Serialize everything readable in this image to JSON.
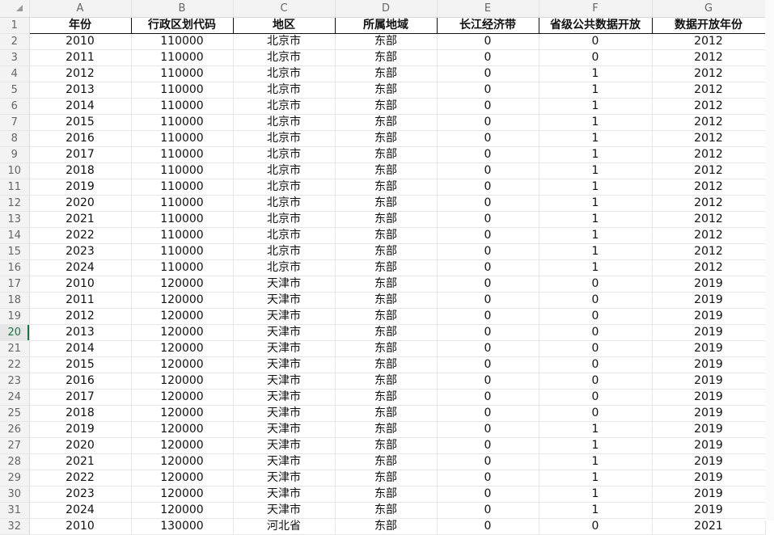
{
  "corner_icon": "select-all-triangle-icon",
  "columns": [
    "A",
    "B",
    "C",
    "D",
    "E",
    "F",
    "G"
  ],
  "active_row": 20,
  "header": {
    "row": 1,
    "cells": [
      "年份",
      "行政区划代码",
      "地区",
      "所属地域",
      "长江经济带",
      "省级公共数据开放",
      "数据开放年份"
    ]
  },
  "rows": [
    {
      "n": 2,
      "cells": [
        "2010",
        "110000",
        "北京市",
        "东部",
        "0",
        "0",
        "2012"
      ]
    },
    {
      "n": 3,
      "cells": [
        "2011",
        "110000",
        "北京市",
        "东部",
        "0",
        "0",
        "2012"
      ]
    },
    {
      "n": 4,
      "cells": [
        "2012",
        "110000",
        "北京市",
        "东部",
        "0",
        "1",
        "2012"
      ]
    },
    {
      "n": 5,
      "cells": [
        "2013",
        "110000",
        "北京市",
        "东部",
        "0",
        "1",
        "2012"
      ]
    },
    {
      "n": 6,
      "cells": [
        "2014",
        "110000",
        "北京市",
        "东部",
        "0",
        "1",
        "2012"
      ]
    },
    {
      "n": 7,
      "cells": [
        "2015",
        "110000",
        "北京市",
        "东部",
        "0",
        "1",
        "2012"
      ]
    },
    {
      "n": 8,
      "cells": [
        "2016",
        "110000",
        "北京市",
        "东部",
        "0",
        "1",
        "2012"
      ]
    },
    {
      "n": 9,
      "cells": [
        "2017",
        "110000",
        "北京市",
        "东部",
        "0",
        "1",
        "2012"
      ]
    },
    {
      "n": 10,
      "cells": [
        "2018",
        "110000",
        "北京市",
        "东部",
        "0",
        "1",
        "2012"
      ]
    },
    {
      "n": 11,
      "cells": [
        "2019",
        "110000",
        "北京市",
        "东部",
        "0",
        "1",
        "2012"
      ]
    },
    {
      "n": 12,
      "cells": [
        "2020",
        "110000",
        "北京市",
        "东部",
        "0",
        "1",
        "2012"
      ]
    },
    {
      "n": 13,
      "cells": [
        "2021",
        "110000",
        "北京市",
        "东部",
        "0",
        "1",
        "2012"
      ]
    },
    {
      "n": 14,
      "cells": [
        "2022",
        "110000",
        "北京市",
        "东部",
        "0",
        "1",
        "2012"
      ]
    },
    {
      "n": 15,
      "cells": [
        "2023",
        "110000",
        "北京市",
        "东部",
        "0",
        "1",
        "2012"
      ]
    },
    {
      "n": 16,
      "cells": [
        "2024",
        "110000",
        "北京市",
        "东部",
        "0",
        "1",
        "2012"
      ]
    },
    {
      "n": 17,
      "cells": [
        "2010",
        "120000",
        "天津市",
        "东部",
        "0",
        "0",
        "2019"
      ]
    },
    {
      "n": 18,
      "cells": [
        "2011",
        "120000",
        "天津市",
        "东部",
        "0",
        "0",
        "2019"
      ]
    },
    {
      "n": 19,
      "cells": [
        "2012",
        "120000",
        "天津市",
        "东部",
        "0",
        "0",
        "2019"
      ]
    },
    {
      "n": 20,
      "cells": [
        "2013",
        "120000",
        "天津市",
        "东部",
        "0",
        "0",
        "2019"
      ]
    },
    {
      "n": 21,
      "cells": [
        "2014",
        "120000",
        "天津市",
        "东部",
        "0",
        "0",
        "2019"
      ]
    },
    {
      "n": 22,
      "cells": [
        "2015",
        "120000",
        "天津市",
        "东部",
        "0",
        "0",
        "2019"
      ]
    },
    {
      "n": 23,
      "cells": [
        "2016",
        "120000",
        "天津市",
        "东部",
        "0",
        "0",
        "2019"
      ]
    },
    {
      "n": 24,
      "cells": [
        "2017",
        "120000",
        "天津市",
        "东部",
        "0",
        "0",
        "2019"
      ]
    },
    {
      "n": 25,
      "cells": [
        "2018",
        "120000",
        "天津市",
        "东部",
        "0",
        "0",
        "2019"
      ]
    },
    {
      "n": 26,
      "cells": [
        "2019",
        "120000",
        "天津市",
        "东部",
        "0",
        "1",
        "2019"
      ]
    },
    {
      "n": 27,
      "cells": [
        "2020",
        "120000",
        "天津市",
        "东部",
        "0",
        "1",
        "2019"
      ]
    },
    {
      "n": 28,
      "cells": [
        "2021",
        "120000",
        "天津市",
        "东部",
        "0",
        "1",
        "2019"
      ]
    },
    {
      "n": 29,
      "cells": [
        "2022",
        "120000",
        "天津市",
        "东部",
        "0",
        "1",
        "2019"
      ]
    },
    {
      "n": 30,
      "cells": [
        "2023",
        "120000",
        "天津市",
        "东部",
        "0",
        "1",
        "2019"
      ]
    },
    {
      "n": 31,
      "cells": [
        "2024",
        "120000",
        "天津市",
        "东部",
        "0",
        "1",
        "2019"
      ]
    },
    {
      "n": 32,
      "cells": [
        "2010",
        "130000",
        "河北省",
        "东部",
        "0",
        "0",
        "2021"
      ]
    }
  ]
}
